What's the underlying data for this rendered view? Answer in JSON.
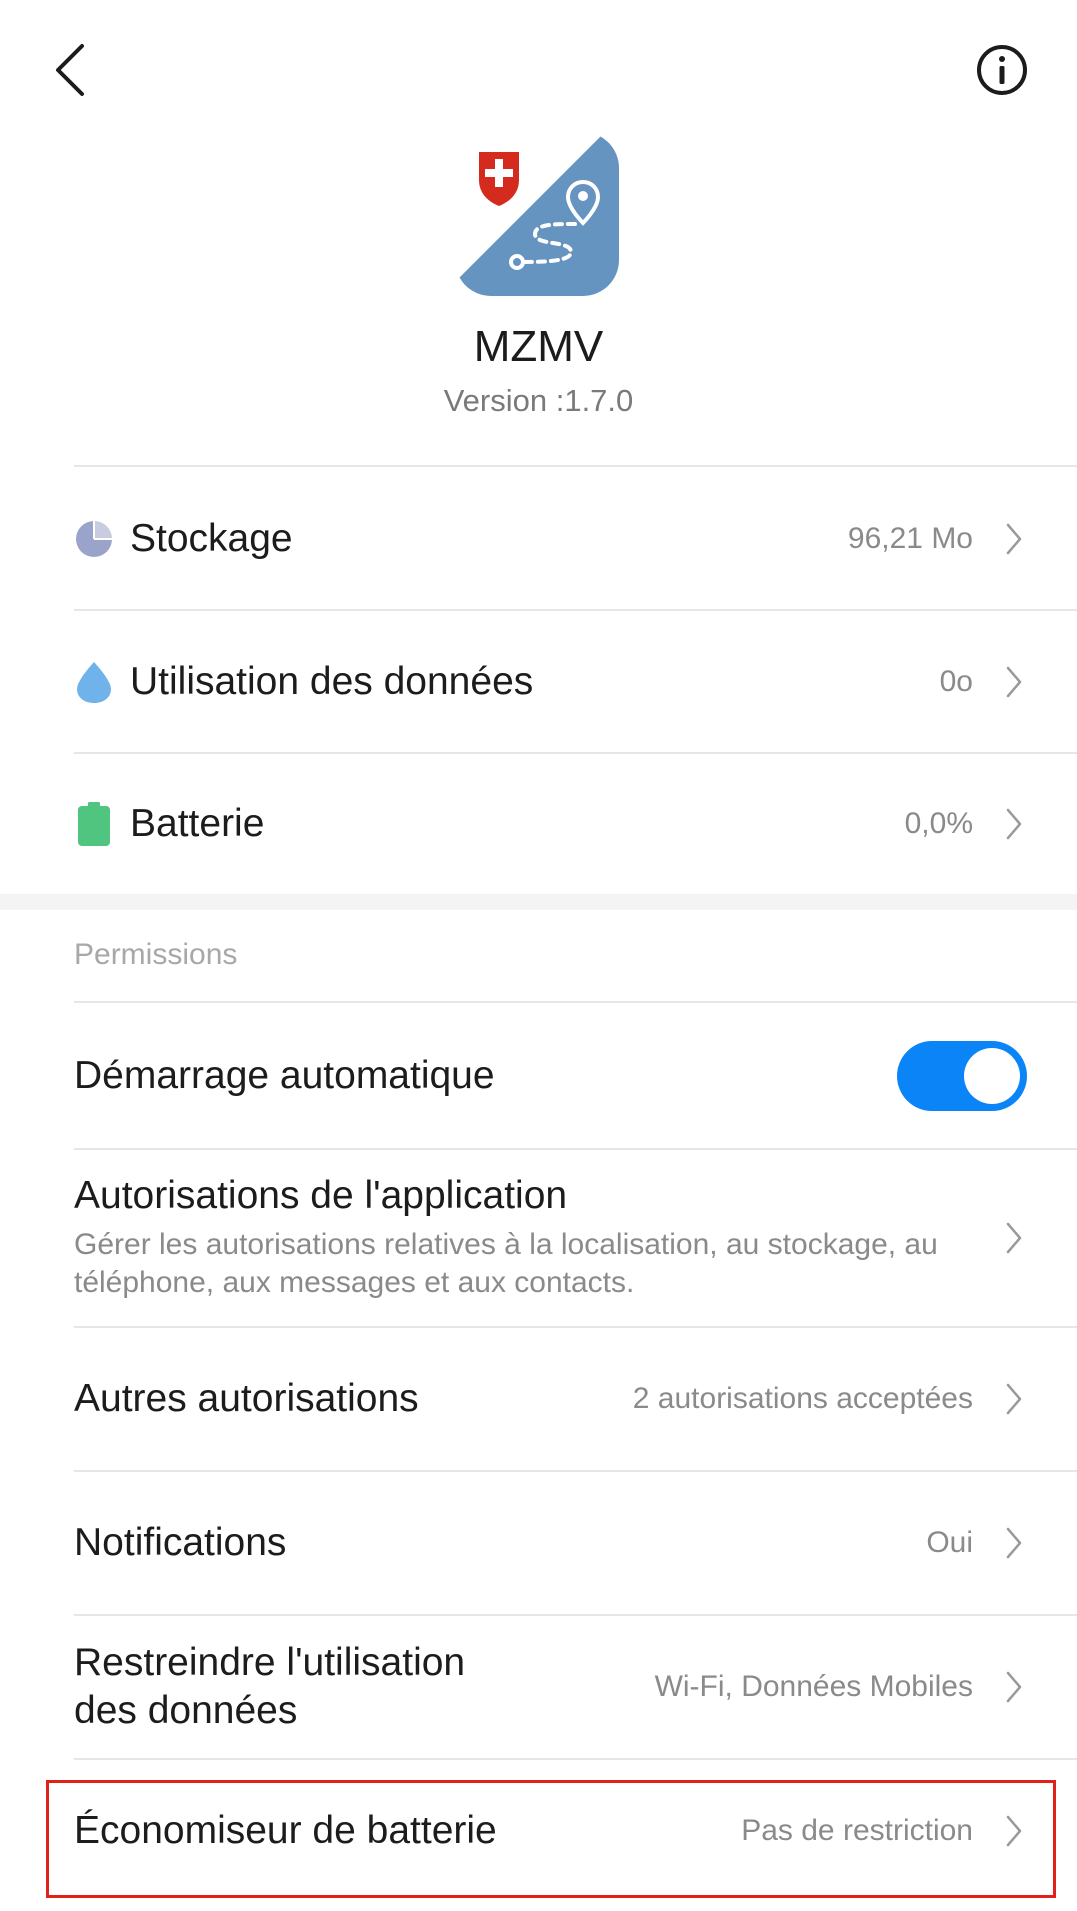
{
  "app": {
    "name": "MZMV",
    "version": "Version :1.7.0"
  },
  "icons": {
    "back": "back-arrow-icon",
    "info": "info-icon",
    "storage": "pie-chart-icon",
    "data": "water-drop-icon",
    "battery": "battery-icon",
    "chevron": "chevron-right-icon"
  },
  "colors": {
    "toggle_on": "#0a84f7",
    "storage_icon": "#9aa3c9",
    "data_icon": "#6fb3ea",
    "battery_icon": "#4fc57f",
    "app_icon_bg": "#6694c0",
    "swiss_red": "#d52b1e",
    "highlight": "#e0201a"
  },
  "usage": {
    "storage": {
      "label": "Stockage",
      "value": "96,21 Mo"
    },
    "data": {
      "label": "Utilisation des données",
      "value": "0o"
    },
    "battery": {
      "label": "Batterie",
      "value": "0,0%"
    }
  },
  "permissions": {
    "header": "Permissions",
    "autostart": {
      "label": "Démarrage automatique",
      "enabled": true
    },
    "app_permissions": {
      "label": "Autorisations de l'application",
      "description": "Gérer les autorisations relatives à la localisation, au stockage, au téléphone, aux messages et aux contacts."
    },
    "other_permissions": {
      "label": "Autres autorisations",
      "value": "2 autorisations acceptées"
    },
    "notifications": {
      "label": "Notifications",
      "value": "Oui"
    },
    "restrict_data": {
      "label_line1": "Restreindre l'utilisation",
      "label_line2": "des données",
      "value": "Wi-Fi, Données Mobiles"
    },
    "battery_saver": {
      "label": "Économiseur de batterie",
      "value": "Pas de restriction"
    }
  }
}
